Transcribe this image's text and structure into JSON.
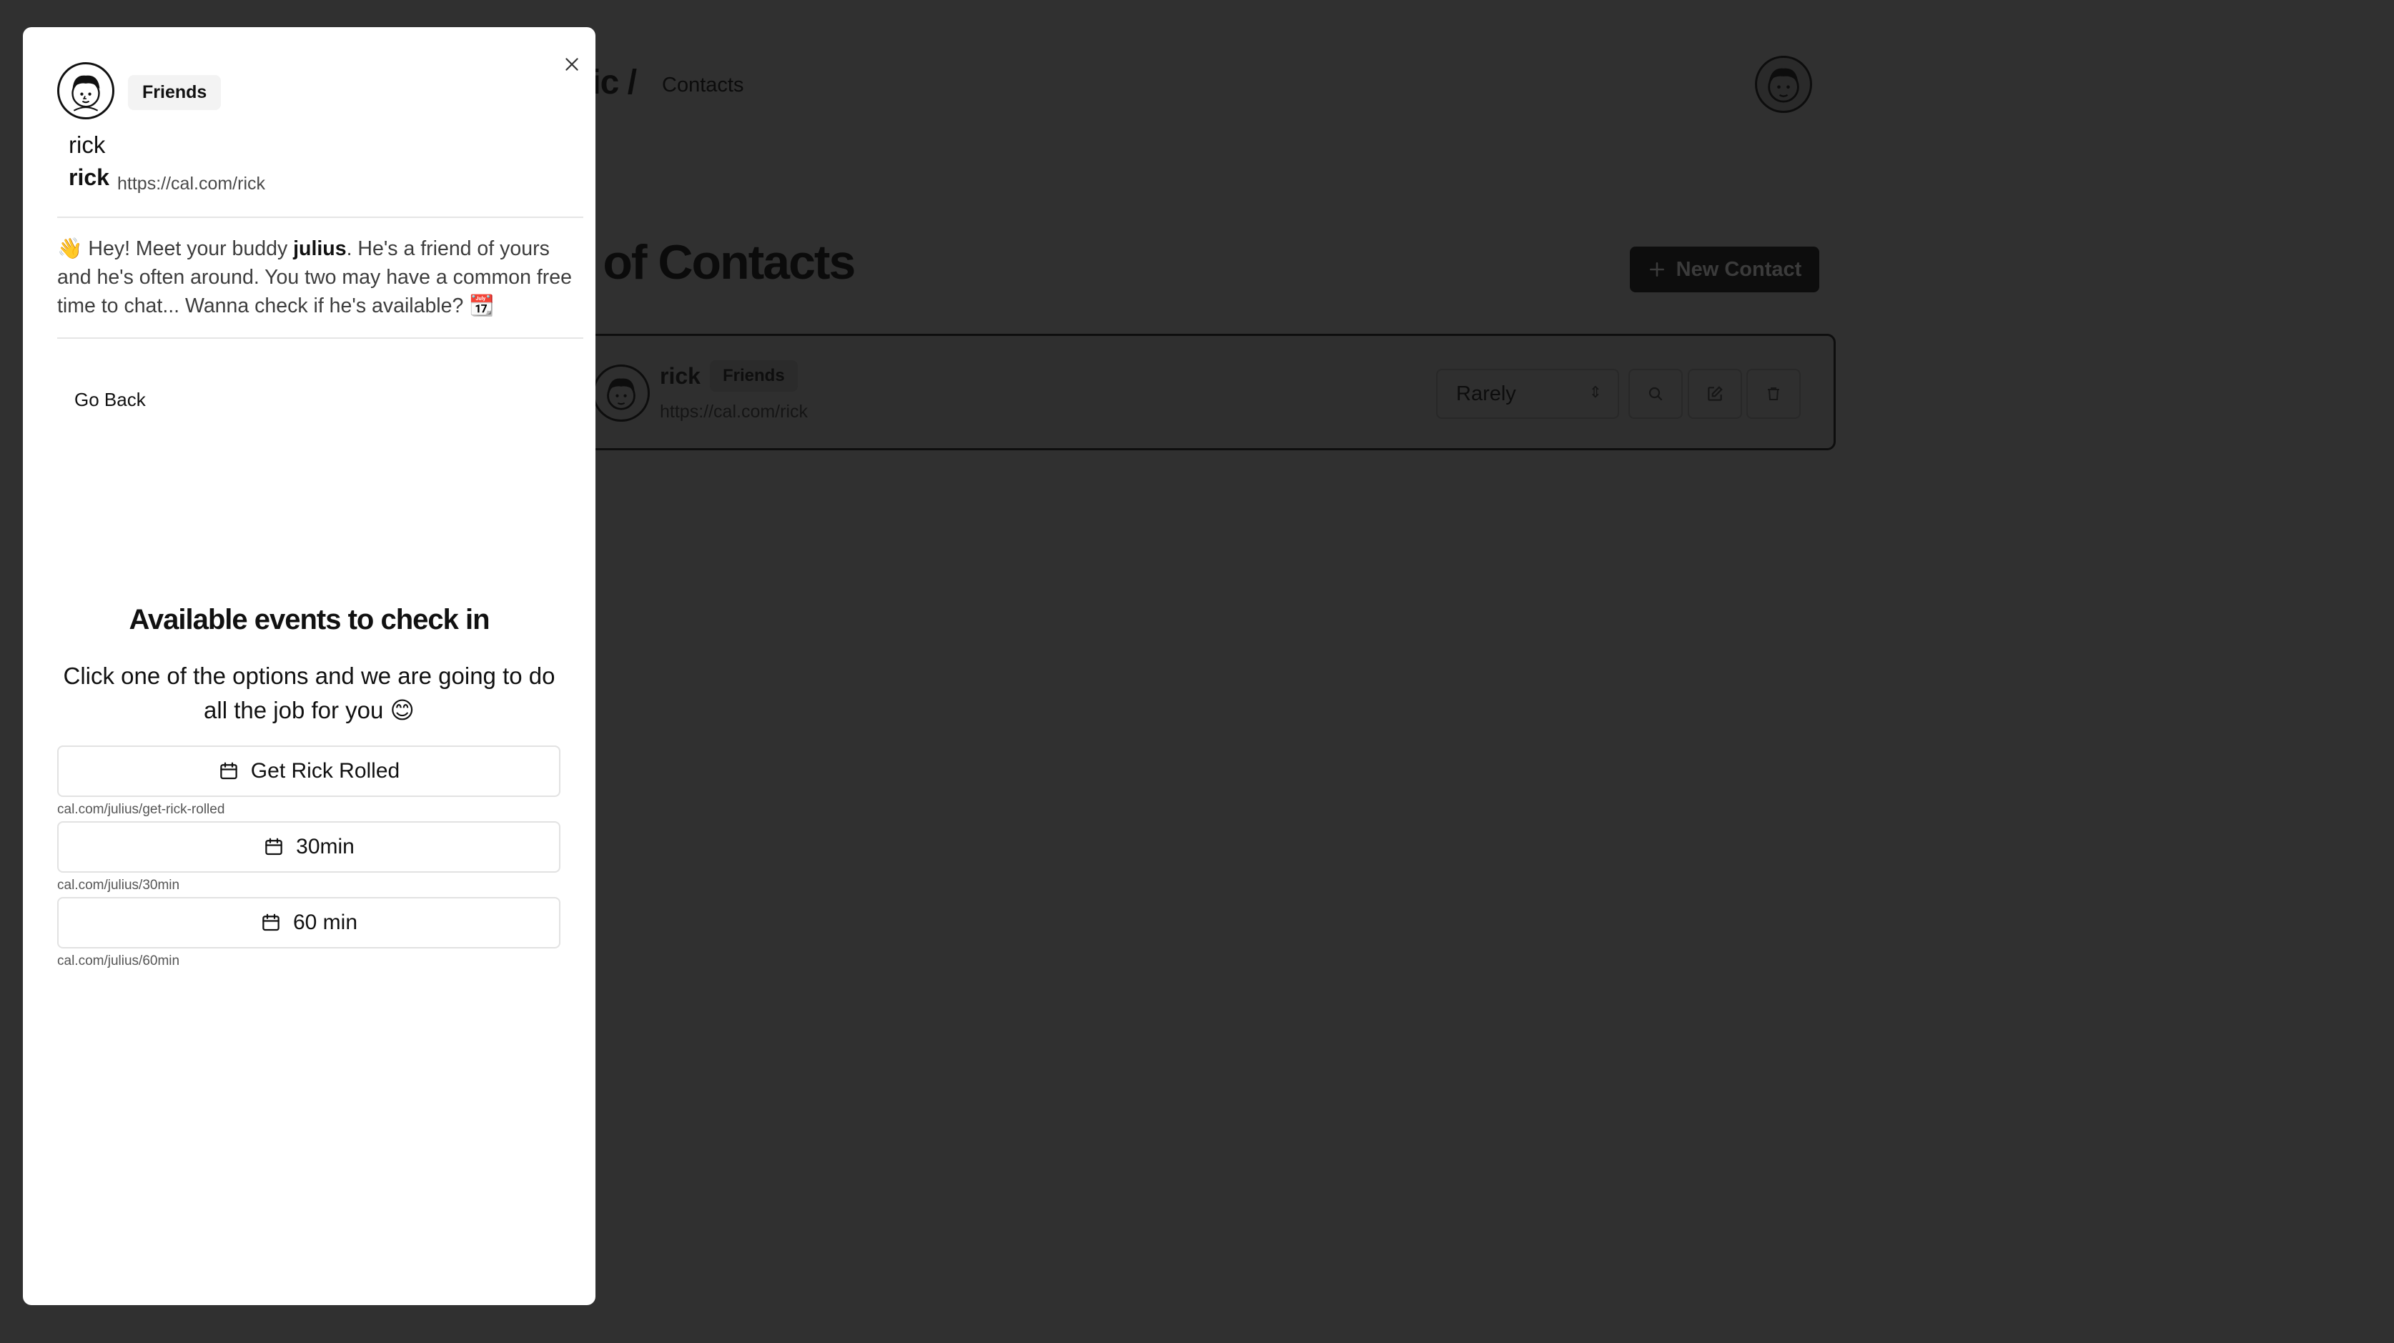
{
  "background": {
    "brand_crumb": "lic /",
    "breadcrumb_current": "Contacts",
    "page_title": "st of Contacts",
    "new_contact_label": "New Contact",
    "contact": {
      "name": "rick",
      "tag": "Friends",
      "url": "https://cal.com/rick",
      "frequency": "Rarely"
    }
  },
  "modal": {
    "tag": "Friends",
    "name": "rick",
    "handle": "rick",
    "url": "https://cal.com/rick",
    "message": {
      "part1": "👋 Hey! Meet your buddy ",
      "buddy": "julius",
      "part2": ". He's a friend of yours and he's often around. You two may have a common free time to chat... Wanna check if he's available? 📆"
    },
    "go_back_label": "Go Back",
    "events_title": "Available events to check in",
    "events_subtitle": "Click one of the options and we are going to do all the job for you 😊",
    "events": [
      {
        "label": "Get Rick Rolled",
        "link": "cal.com/julius/get-rick-rolled"
      },
      {
        "label": "30min",
        "link": "cal.com/julius/30min"
      },
      {
        "label": "60 min",
        "link": "cal.com/julius/60min"
      }
    ]
  },
  "icons": {
    "close": "close-icon",
    "calendar": "calendar-icon",
    "plus": "plus-icon",
    "search": "search-icon",
    "edit": "edit-icon",
    "delete": "trash-icon"
  }
}
